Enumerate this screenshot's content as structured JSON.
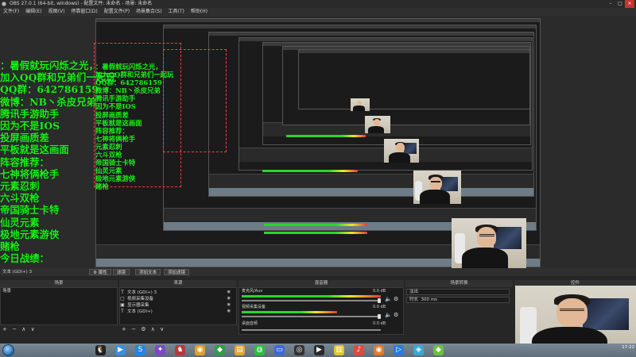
{
  "window": {
    "title": "OBS 27.0.1 (64-bit, windows) - 配置文件: 未命名 - 场景: 未命名",
    "controls": {
      "minimize": "–",
      "maximize": "□",
      "close": "×"
    }
  },
  "menu": [
    "文件(F)",
    "编辑(E)",
    "视图(V)",
    "停靠窗口(D)",
    "配置文件(P)",
    "场景集合(S)",
    "工具(T)",
    "帮助(H)"
  ],
  "overlay": {
    "lines": [
      "：暑假就玩闪烁之光，",
      "加入QQ群和兄弟们一起玩",
      "QQ群：642786159",
      "微博：NB丶杀皮兄弟",
      "腾讯手游助手",
      "因为不是IOS",
      "投屏画质差",
      "平板就是这画面",
      "阵容推荐：",
      "七神将俩枪手",
      "元素忍刺",
      "六斗双枪",
      "帝国骑士卡特",
      "仙灵元素",
      "极地元素游侠",
      "赌枪",
      "今日战绩："
    ],
    "color": "#19f119"
  },
  "context_bar": {
    "text": "文本 (GDI+) 3",
    "props_label": "属性",
    "filters_label": "滤镜",
    "add_text_label": "添加文本",
    "add_filter_label": "添加滤镜"
  },
  "docks": {
    "scenes": {
      "title": "场景",
      "items": [
        "场景"
      ]
    },
    "sources": {
      "title": "来源",
      "items": [
        {
          "icon": "T",
          "label": "文本 (GDI+) 3"
        },
        {
          "icon": "▢",
          "label": "视频采集设备"
        },
        {
          "icon": "▣",
          "label": "显示器采集"
        },
        {
          "icon": "T",
          "label": "文本 (GDI+)"
        }
      ]
    },
    "mixer": {
      "title": "混音器",
      "channels": [
        {
          "name": "麦克风/Aux",
          "db": "0.0 dB"
        },
        {
          "name": "视频采集设备",
          "db": "0.0 dB"
        },
        {
          "name": "桌面音频",
          "db": "0.0 dB"
        }
      ]
    },
    "transitions": {
      "title": "场景转换",
      "selected": "淡出",
      "duration_label": "时长",
      "duration_value": "300 ms"
    },
    "controls": {
      "title": "控件"
    }
  },
  "footer_symbols": {
    "add": "+",
    "remove": "−",
    "up": "∧",
    "down": "∨",
    "gear": "⚙"
  },
  "taskbar": {
    "clock": "17:22",
    "date": "2021/7/20",
    "apps": [
      {
        "name": "qq-icon",
        "glyph": "🐧",
        "color": "#222"
      },
      {
        "name": "media-player-icon",
        "glyph": "▶",
        "color": "#3a8ee0"
      },
      {
        "name": "browser-icon",
        "glyph": "S",
        "color": "#1e88e5"
      },
      {
        "name": "game-icon",
        "glyph": "✦",
        "color": "#7b4bc4"
      },
      {
        "name": "game-icon-2",
        "glyph": "♞",
        "color": "#b53a3a"
      },
      {
        "name": "chrome-icon",
        "glyph": "◉",
        "color": "#e0a02b"
      },
      {
        "name": "security-icon",
        "glyph": "◆",
        "color": "#2ea043"
      },
      {
        "name": "folder-icon",
        "glyph": "▤",
        "color": "#e6a62b"
      },
      {
        "name": "wechat-icon",
        "glyph": "◍",
        "color": "#2bbf3a"
      },
      {
        "name": "monitor-icon",
        "glyph": "▭",
        "color": "#3a6ad6"
      },
      {
        "name": "obs-icon",
        "glyph": "◎",
        "color": "#333"
      },
      {
        "name": "player-icon",
        "glyph": "▶",
        "color": "#2b2b2b"
      },
      {
        "name": "note-icon",
        "glyph": "▥",
        "color": "#e8c42b"
      },
      {
        "name": "music-icon",
        "glyph": "♪",
        "color": "#e04a3a"
      },
      {
        "name": "browser-icon-2",
        "glyph": "◉",
        "color": "#e07a2b"
      },
      {
        "name": "video-icon",
        "glyph": "▷",
        "color": "#2b7ae0"
      },
      {
        "name": "assistant-icon",
        "glyph": "◈",
        "color": "#38a8d8"
      },
      {
        "name": "app-icon-extra",
        "glyph": "◆",
        "color": "#6ac13a"
      }
    ]
  }
}
